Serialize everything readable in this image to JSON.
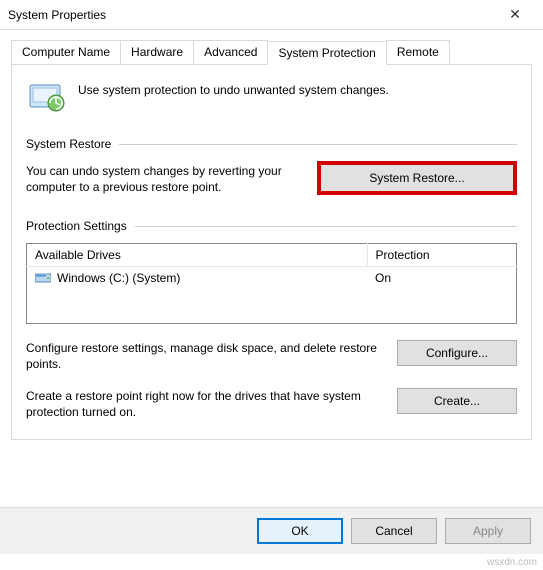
{
  "window": {
    "title": "System Properties"
  },
  "tabs": {
    "computer_name": "Computer Name",
    "hardware": "Hardware",
    "advanced": "Advanced",
    "system_protection": "System Protection",
    "remote": "Remote"
  },
  "intro": "Use system protection to undo unwanted system changes.",
  "sections": {
    "restore_header": "System Restore",
    "restore_text": "You can undo system changes by reverting your computer to a previous restore point.",
    "restore_button": "System Restore...",
    "protection_header": "Protection Settings",
    "configure_text": "Configure restore settings, manage disk space, and delete restore points.",
    "configure_button": "Configure...",
    "create_text": "Create a restore point right now for the drives that have system protection turned on.",
    "create_button": "Create..."
  },
  "drives": {
    "headers": {
      "drive": "Available Drives",
      "protection": "Protection"
    },
    "rows": [
      {
        "name": "Windows (C:) (System)",
        "protection": "On"
      }
    ]
  },
  "footer": {
    "ok": "OK",
    "cancel": "Cancel",
    "apply": "Apply"
  },
  "watermark": "wsxdn.com"
}
